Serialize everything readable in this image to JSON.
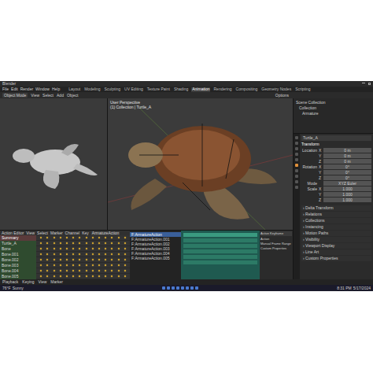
{
  "window": {
    "title": "Blender"
  },
  "menu": [
    "File",
    "Edit",
    "Render",
    "Window",
    "Help"
  ],
  "workspaces": [
    {
      "label": "Layout",
      "selected": false
    },
    {
      "label": "Modeling",
      "selected": false
    },
    {
      "label": "Sculpting",
      "selected": false
    },
    {
      "label": "UV Editing",
      "selected": false
    },
    {
      "label": "Texture Paint",
      "selected": false
    },
    {
      "label": "Shading",
      "selected": false
    },
    {
      "label": "Animation",
      "selected": true
    },
    {
      "label": "Rendering",
      "selected": false
    },
    {
      "label": "Compositing",
      "selected": false
    },
    {
      "label": "Geometry Nodes",
      "selected": false
    },
    {
      "label": "Scripting",
      "selected": false
    }
  ],
  "toolbar": {
    "mode": "Object Mode",
    "items": [
      "View",
      "Select",
      "Add",
      "Object"
    ],
    "options": "Options"
  },
  "viewport": {
    "perspective": "User Perspective",
    "collection": "(1) Collection | Turtle_A"
  },
  "outliner": {
    "items": [
      "Scene Collection",
      "Collection",
      "Armature"
    ]
  },
  "properties": {
    "object": "Turtle_A",
    "panel": "Transform",
    "groups": [
      {
        "label": "Location",
        "fields": [
          {
            "axis": "X",
            "value": "0 m"
          },
          {
            "axis": "Y",
            "value": "0 m"
          },
          {
            "axis": "Z",
            "value": "0 m"
          }
        ]
      },
      {
        "label": "Rotation",
        "fields": [
          {
            "axis": "X",
            "value": "0°"
          },
          {
            "axis": "Y",
            "value": "0°"
          },
          {
            "axis": "Z",
            "value": "0°"
          }
        ]
      },
      {
        "label": "Mode",
        "fields": [
          {
            "axis": "",
            "value": "XYZ Euler"
          }
        ]
      },
      {
        "label": "Scale",
        "fields": [
          {
            "axis": "X",
            "value": "1.000"
          },
          {
            "axis": "Y",
            "value": "1.000"
          },
          {
            "axis": "Z",
            "value": "1.000"
          }
        ]
      }
    ],
    "sections": [
      "Delta Transform",
      "Relations",
      "Collections",
      "Instancing",
      "Motion Paths",
      "Visibility",
      "Viewport Display",
      "Line Art",
      "Custom Properties"
    ]
  },
  "action_editor": {
    "title": "Action Editor",
    "menu": [
      "View",
      "Select",
      "Marker",
      "Channel",
      "Key"
    ],
    "action": "ArmatureAction",
    "channels": [
      {
        "name": "Summary",
        "selected": true
      },
      {
        "name": "Turtle_A",
        "selected": false
      },
      {
        "name": "Bone",
        "selected": false
      },
      {
        "name": "Bone.001",
        "selected": false
      },
      {
        "name": "Bone.002",
        "selected": false
      },
      {
        "name": "Bone.003",
        "selected": false
      },
      {
        "name": "Bone.004",
        "selected": false
      },
      {
        "name": "Bone.005",
        "selected": false
      }
    ]
  },
  "tracks": [
    {
      "name": "F:ArmatureAction",
      "selected": true
    },
    {
      "name": "F:ArmatureAction.001",
      "selected": false
    },
    {
      "name": "F:ArmatureAction.002",
      "selected": false
    },
    {
      "name": "F:ArmatureAction.003",
      "selected": false
    },
    {
      "name": "F:ArmatureAction.004",
      "selected": false
    },
    {
      "name": "F:ArmatureAction.005",
      "selected": false
    }
  ],
  "side_panel": {
    "title": "Active Keyframe",
    "items": [
      "Action",
      "Manual Frame Range",
      "Custom Properties"
    ]
  },
  "status_bar": [
    "Playback",
    "Keying",
    "View",
    "Marker"
  ],
  "taskbar": {
    "weather": "76°F",
    "condition": "Sunny",
    "time": "8:31 PM",
    "date": "5/17/2024"
  }
}
